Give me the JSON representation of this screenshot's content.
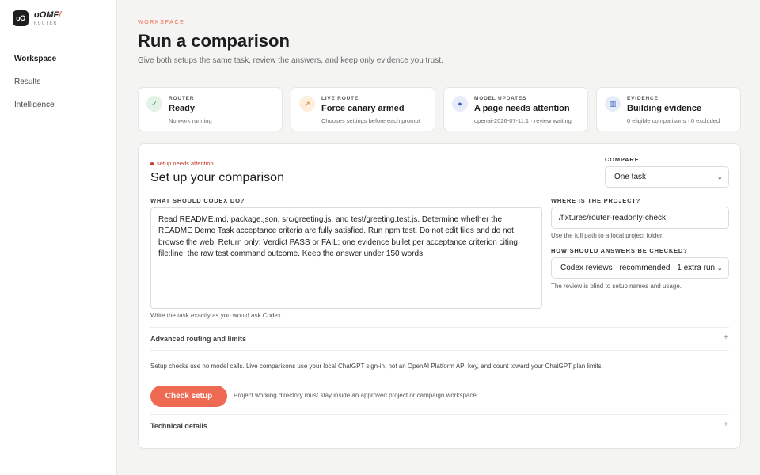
{
  "brand": {
    "logo": "oO",
    "name": "oOMF",
    "mark": "/",
    "sub": "ROUTER"
  },
  "nav": [
    {
      "label": "Workspace",
      "active": true
    },
    {
      "label": "Results",
      "active": false
    },
    {
      "label": "Intelligence",
      "active": false
    }
  ],
  "header": {
    "eyebrow": "WORKSPACE",
    "title": "Run a comparison",
    "subtitle": "Give both setups the same task, review the answers, and keep only evidence you trust."
  },
  "cards": [
    {
      "label": "ROUTER",
      "value": "Ready",
      "note": "No work running",
      "icon": "check-icon",
      "color": "#2f8a4c"
    },
    {
      "label": "LIVE ROUTE",
      "value": "Force canary armed",
      "note": "Chooses settings before each prompt",
      "icon": "arrow-up-right-icon",
      "color": "#d9822b"
    },
    {
      "label": "MODEL UPDATES",
      "value": "A page needs attention",
      "note": "openai-2026-07-11.1 · review waiting",
      "icon": "dot-icon",
      "color": "#3d63c9"
    },
    {
      "label": "EVIDENCE",
      "value": "Building evidence",
      "note": "0 eligible comparisons · 0 excluded",
      "icon": "grid-icon",
      "color": "#3d63c9"
    }
  ],
  "panel": {
    "status": "setup needs attention",
    "title": "Set up your comparison",
    "compare_label": "COMPARE",
    "compare_value": "One task",
    "task_label": "WHAT SHOULD CODEX DO?",
    "task_text": "Read README.md, package.json, src/greeting.js, and test/greeting.test.js. Determine whether the README Demo Task acceptance criteria are fully satisfied. Run npm test. Do not edit files and do not browse the web. Return only: Verdict PASS or FAIL; one evidence bullet per acceptance criterion citing file:line; the raw test command outcome. Keep the answer under 150 words.",
    "task_help": "Write the task exactly as you would ask Codex.",
    "project_label": "WHERE IS THE PROJECT?",
    "project_value": "/fixtures/router-readonly-check",
    "project_help": "Use the full path to a local project folder.",
    "check_label": "HOW SHOULD ANSWERS BE CHECKED?",
    "check_value": "Codex reviews · recommended · 1 extra run",
    "check_help": "The review is blind to setup names and usage.",
    "advanced": "Advanced routing and limits",
    "notice": "Setup checks use no model calls. Live comparisons use your local ChatGPT sign-in, not an OpenAI Platform API key, and count toward your ChatGPT plan limits.",
    "button": "Check setup",
    "button_note": "Project working directory must stay inside an approved project or campaign workspace",
    "technical": "Technical details"
  },
  "colors": {
    "accent": "#ef6a52",
    "error": "#c03a2b"
  }
}
